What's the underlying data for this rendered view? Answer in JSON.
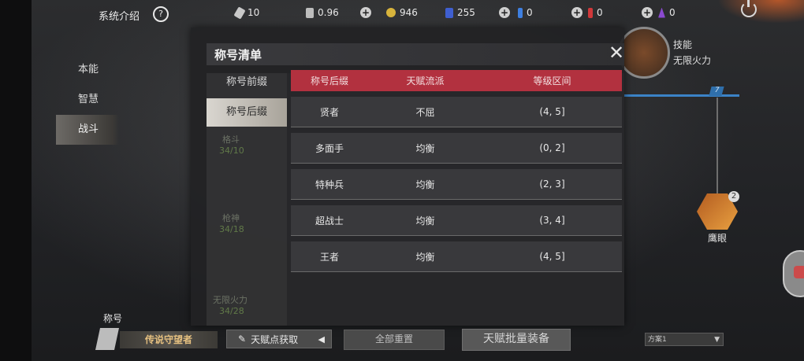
{
  "topbar": {
    "sys_intro": "系统介绍",
    "help_glyph": "?",
    "resources": [
      {
        "icon": "bullet-icon",
        "value": "10"
      },
      {
        "icon": "document-icon",
        "value": "0.96"
      },
      {
        "icon": "gold-coin-icon",
        "value": "946"
      },
      {
        "icon": "card-icon",
        "value": "255"
      },
      {
        "icon": "blue-vial-icon",
        "value": "0"
      },
      {
        "icon": "red-vial-icon",
        "value": "0"
      },
      {
        "icon": "purple-crystal-icon",
        "value": "0"
      }
    ],
    "plus_glyph": "+"
  },
  "side_nav": [
    "本能",
    "智慧",
    "战斗"
  ],
  "side_nav_active": "战斗",
  "skill": {
    "label": "技能",
    "name": "无限火力",
    "badge_number": "7"
  },
  "hawk": {
    "label": "鹰眼",
    "count": "2"
  },
  "background_faded": {
    "card1_label": "格斗",
    "card1_progress": "34/10",
    "card2_label": "枪神",
    "card2_progress": "34/18",
    "card3_label": "无限火力",
    "card3_progress": "34/28"
  },
  "modal": {
    "title": "称号清单",
    "close_glyph": "✕",
    "tabs": [
      "称号前缀",
      "称号后缀"
    ],
    "active_tab": "称号后缀",
    "table": {
      "headers": [
        "称号后缀",
        "天赋流派",
        "等级区间"
      ],
      "rows": [
        [
          "贤者",
          "不屈",
          "(4, 5]"
        ],
        [
          "多面手",
          "均衡",
          "(0, 2]"
        ],
        [
          "特种兵",
          "均衡",
          "(2, 3]"
        ],
        [
          "超战士",
          "均衡",
          "(3, 4]"
        ],
        [
          "王者",
          "均衡",
          "(4, 5]"
        ]
      ]
    }
  },
  "bottom": {
    "title_caption": "称号",
    "title_value": "传说守望者",
    "talent_button": "天赋点获取",
    "reset_button": "全部重置",
    "equip_button": "天赋批量装备",
    "scheme_value": "方案1"
  },
  "colors": {
    "table_header": "#b2313f",
    "title_gold": "#e5c080",
    "blue_line": "#3b83c7",
    "active_tab": "#d9d6d0"
  }
}
